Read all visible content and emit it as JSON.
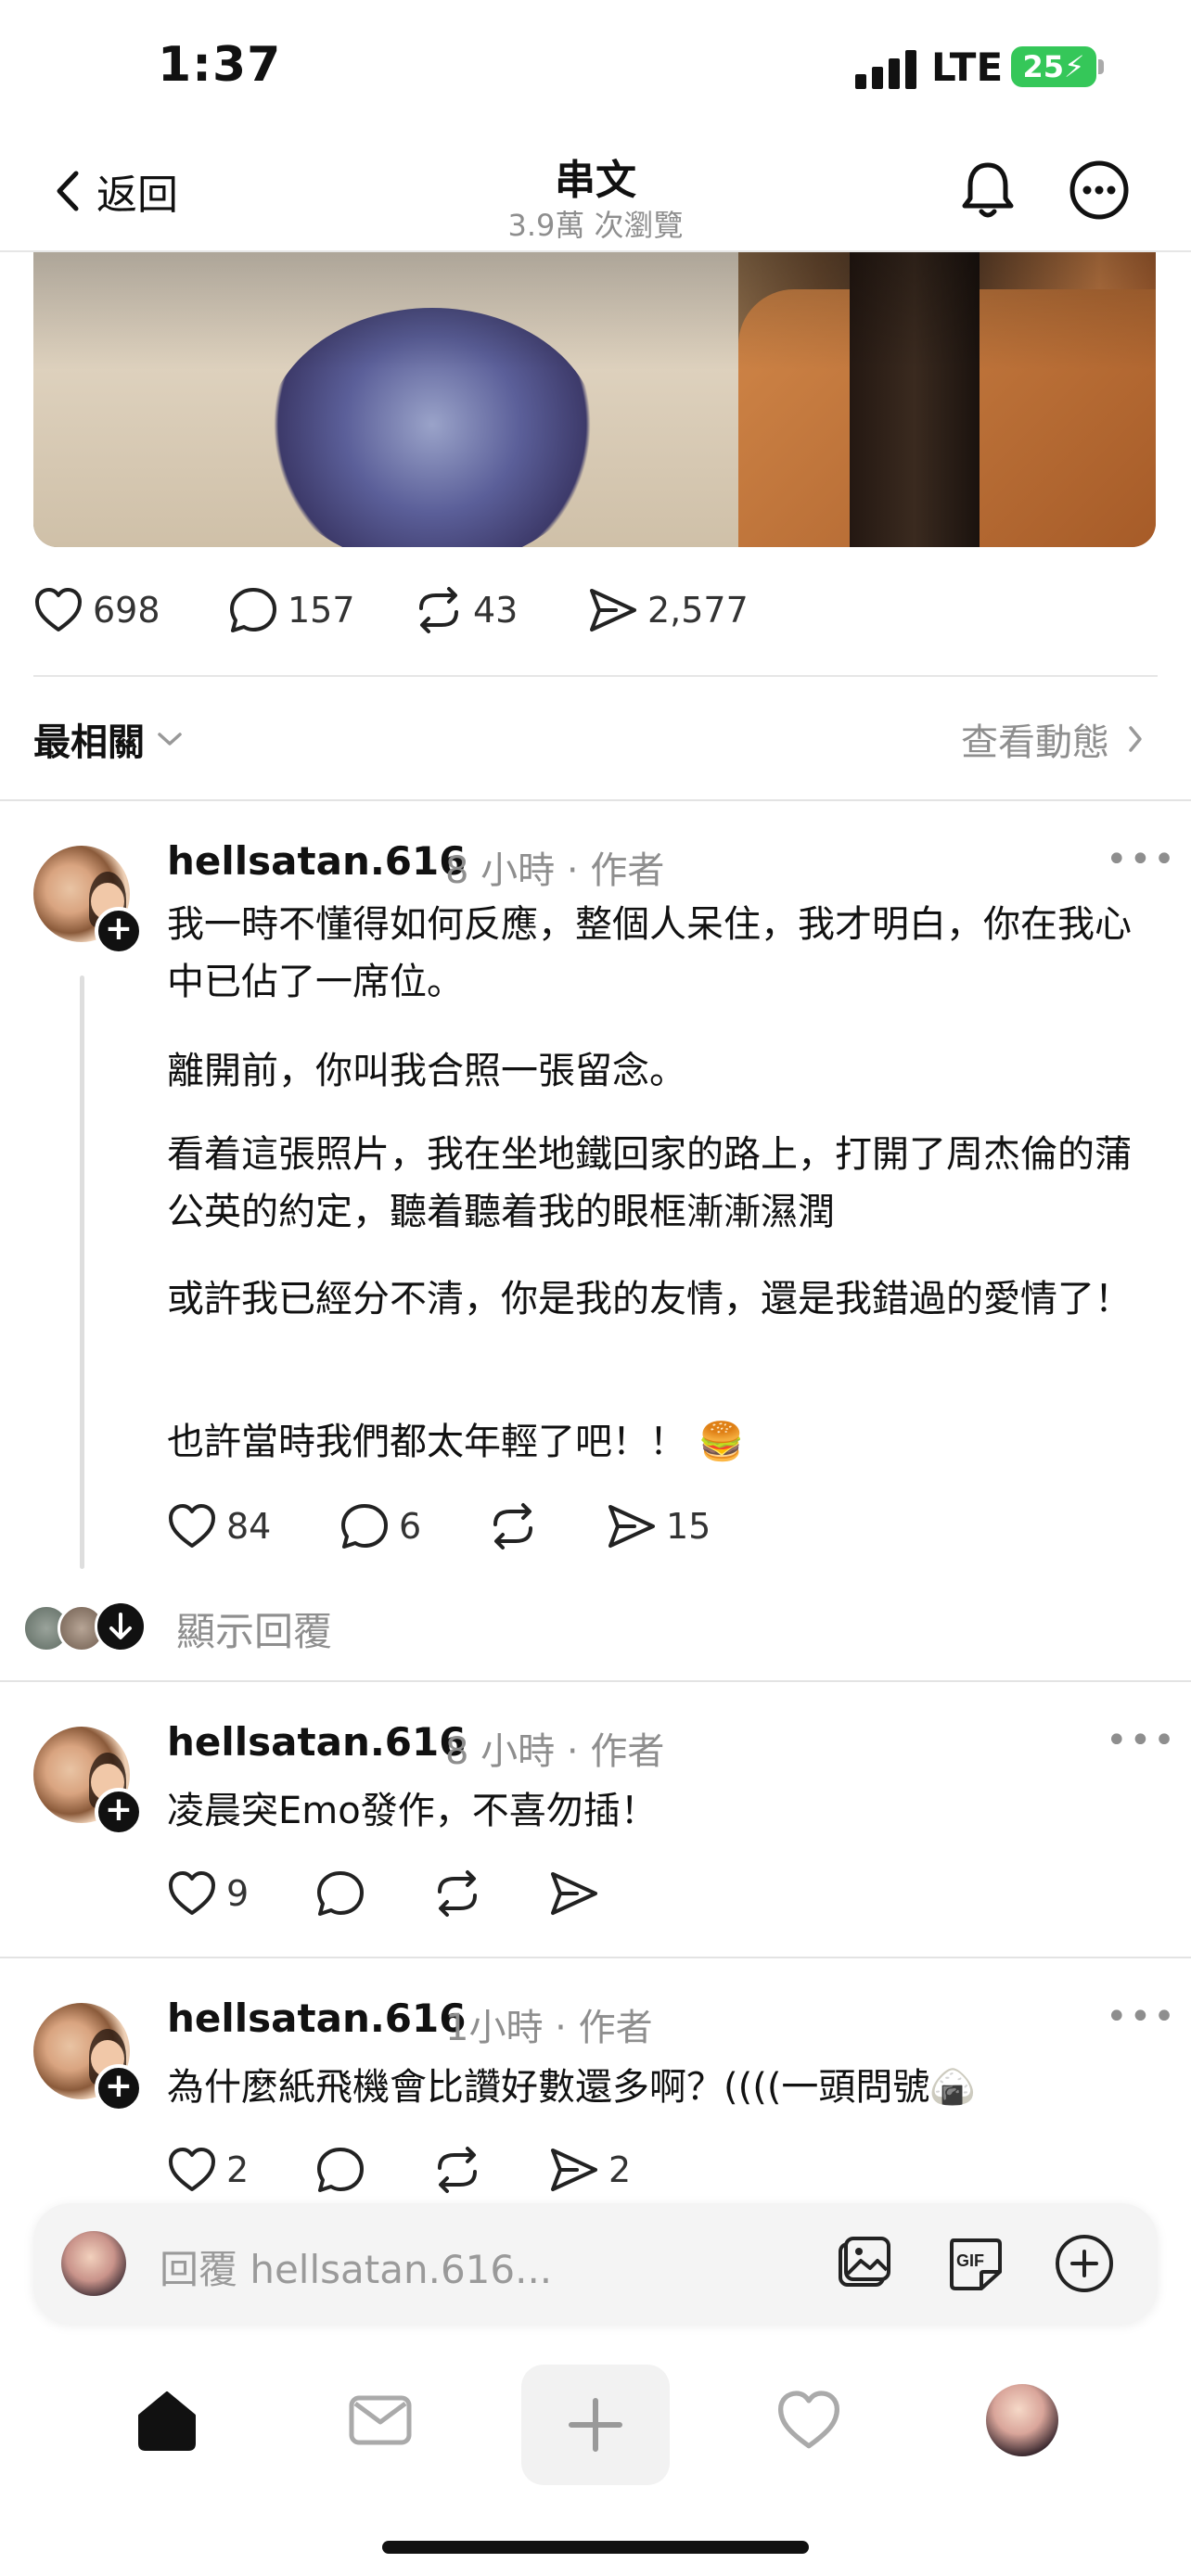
{
  "status_bar": {
    "time": "1:37",
    "network": "LTE",
    "battery": "25"
  },
  "nav": {
    "back_label": "返回",
    "title": "串文",
    "subtitle": "3.9萬 次瀏覽"
  },
  "post_stats": {
    "likes": "698",
    "comments": "157",
    "reposts": "43",
    "shares": "2,577"
  },
  "sort": {
    "label": "最相關",
    "activity_label": "查看動態"
  },
  "comments": [
    {
      "username": "hellsatan.616",
      "time": "8 小時",
      "role": "作者",
      "paragraphs": [
        "我一時不懂得如何反應，整個人呆住，我才明白，你在我心中已佔了一席位。",
        "離開前，你叫我合照一張留念。",
        "看着這張照片，我在坐地鐵回家的路上，打開了周杰倫的蒲公英的約定，聽着聽着我的眼框漸漸濕潤",
        "或許我已經分不清，你是我的友情，還是我錯過的愛情了！",
        "也許當時我們都太年輕了吧！！ 🍔"
      ],
      "likes": "84",
      "comments": "6",
      "reposts": "",
      "shares": "15",
      "show_replies": "顯示回覆"
    },
    {
      "username": "hellsatan.616",
      "time": "8 小時",
      "role": "作者",
      "text": "凌晨突Emo發作，不喜勿插！",
      "likes": "9",
      "comments": "",
      "reposts": "",
      "shares": ""
    },
    {
      "username": "hellsatan.616",
      "time": "1小時",
      "role": "作者",
      "text": "為什麼紙飛機會比讚好數還多啊？((((一頭問號🍙",
      "likes": "2",
      "comments": "",
      "reposts": "",
      "shares": "2"
    }
  ],
  "reply_bar": {
    "placeholder": "回覆 hellsatan.616..."
  },
  "icons": {
    "back": "chevron-left-icon",
    "bell": "bell-icon",
    "more": "more-circle-icon",
    "heart": "heart-icon",
    "comment": "comment-icon",
    "repost": "repost-icon",
    "share": "share-icon",
    "image": "image-icon",
    "gif": "gif-icon",
    "add": "plus-circle-icon",
    "home": "home-icon",
    "inbox": "inbox-icon",
    "create": "plus-icon",
    "activity": "heart-icon",
    "profile": "avatar"
  }
}
